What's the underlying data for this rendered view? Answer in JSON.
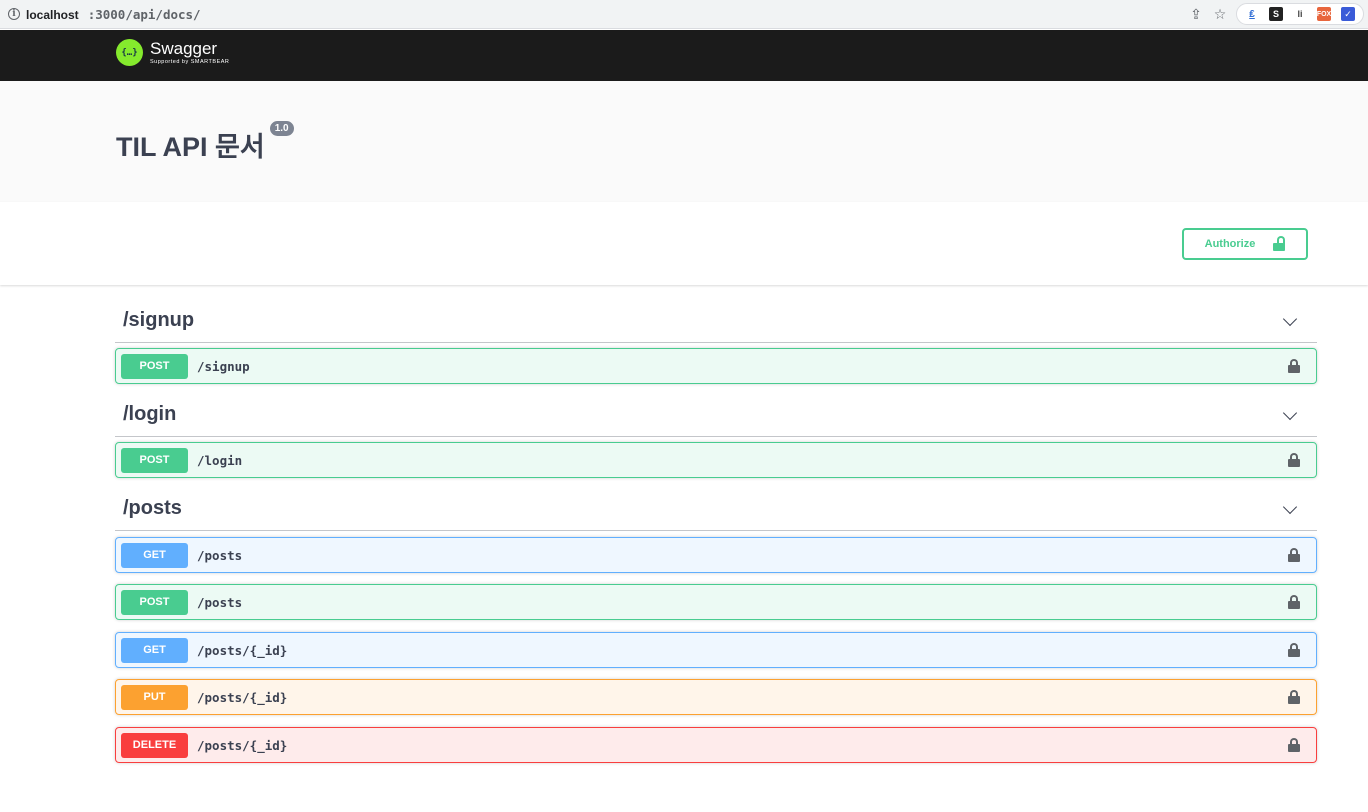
{
  "browser": {
    "url_host": "localhost",
    "url_path": ":3000/api/docs/",
    "extensions": [
      "₤",
      "S",
      "li",
      "FOX",
      "✓"
    ]
  },
  "brand": {
    "name": "Swagger",
    "sub": "Supported by SMARTBEAR",
    "badge": "{…}",
    "accent": "#85ea2d"
  },
  "info": {
    "title": "TIL API 문서",
    "version": "1.0"
  },
  "authorize": {
    "label": "Authorize",
    "color": "#49cc90"
  },
  "method_colors": {
    "POST": "#49cc90",
    "GET": "#61affe",
    "PUT": "#fca130",
    "DELETE": "#f93e3e"
  },
  "tags": [
    {
      "name": "/signup",
      "operations": [
        {
          "method": "POST",
          "path": "/signup"
        }
      ]
    },
    {
      "name": "/login",
      "operations": [
        {
          "method": "POST",
          "path": "/login"
        }
      ]
    },
    {
      "name": "/posts",
      "operations": [
        {
          "method": "GET",
          "path": "/posts"
        },
        {
          "method": "POST",
          "path": "/posts"
        },
        {
          "method": "GET",
          "path": "/posts/{_id}"
        },
        {
          "method": "PUT",
          "path": "/posts/{_id}"
        },
        {
          "method": "DELETE",
          "path": "/posts/{_id}"
        }
      ]
    }
  ]
}
